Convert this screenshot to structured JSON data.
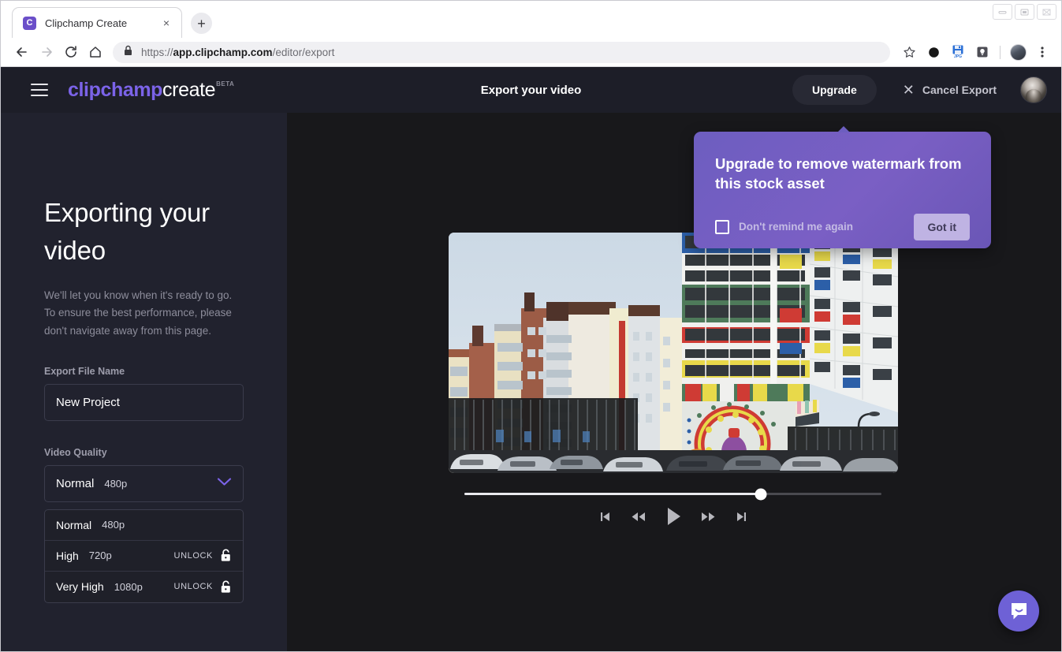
{
  "browser": {
    "tab": {
      "title": "Clipchamp Create",
      "favicon_letter": "C",
      "close_label": "×"
    },
    "new_tab_label": "+",
    "url": {
      "scheme": "https://",
      "host": "app.clipchamp.com",
      "path": "/editor/export"
    },
    "nav": {
      "back": "back-arrow",
      "forward": "forward-arrow",
      "reload": "reload",
      "home": "home"
    },
    "window_controls": {
      "minimize": "minimize",
      "maximize": "maximize",
      "close": "close"
    },
    "toolbar_icons": [
      "bookmark-star-icon",
      "dark-circle-extension-icon",
      "jpg-save-extension-icon",
      "lightbulb-extension-icon",
      "profile-avatar",
      "browser-menu-icon"
    ],
    "jpg_label": "JPG"
  },
  "app_header": {
    "menu": "hamburger-menu",
    "logo": {
      "part1": "clipchamp",
      "part2": "create",
      "beta": "BETA"
    },
    "title": "Export your video",
    "upgrade_label": "Upgrade",
    "cancel_label": "Cancel Export",
    "cancel_icon": "✕"
  },
  "sidebar": {
    "heading": "Exporting your video",
    "subtext": "We'll let you know when it's ready to go.\nTo ensure the best performance, please don't navigate away from this page.",
    "file_name_label": "Export File Name",
    "file_name_value": "New Project",
    "file_name_placeholder": "New Project",
    "quality_label": "Video Quality",
    "quality_selected": {
      "name": "Normal",
      "resolution": "480p"
    },
    "quality_options": [
      {
        "name": "Normal",
        "resolution": "480p",
        "locked": false,
        "unlock_label": ""
      },
      {
        "name": "High",
        "resolution": "720p",
        "locked": true,
        "unlock_label": "UNLOCK"
      },
      {
        "name": "Very High",
        "resolution": "1080p",
        "locked": true,
        "unlock_label": "UNLOCK"
      }
    ]
  },
  "player": {
    "progress_percent": 71,
    "controls": [
      {
        "name": "skip-to-start",
        "glyph": "skip-back"
      },
      {
        "name": "rewind",
        "glyph": "rewind"
      },
      {
        "name": "play",
        "glyph": "play"
      },
      {
        "name": "fast-forward",
        "glyph": "fast-forward"
      },
      {
        "name": "skip-to-end",
        "glyph": "skip-forward"
      }
    ]
  },
  "popover": {
    "title": "Upgrade to remove watermark from this stock asset",
    "checkbox_label": "Don't remind me again",
    "button_label": "Got it"
  },
  "chat": {
    "widget": "intercom-chat-launcher"
  },
  "colors": {
    "brand_purple": "#7b63e8",
    "popover_purple": "#6d5ec0",
    "header_bg": "#1d1e28",
    "sidebar_bg": "#21222e",
    "main_bg": "#18181b",
    "intercom_purple": "#6e61d6"
  }
}
